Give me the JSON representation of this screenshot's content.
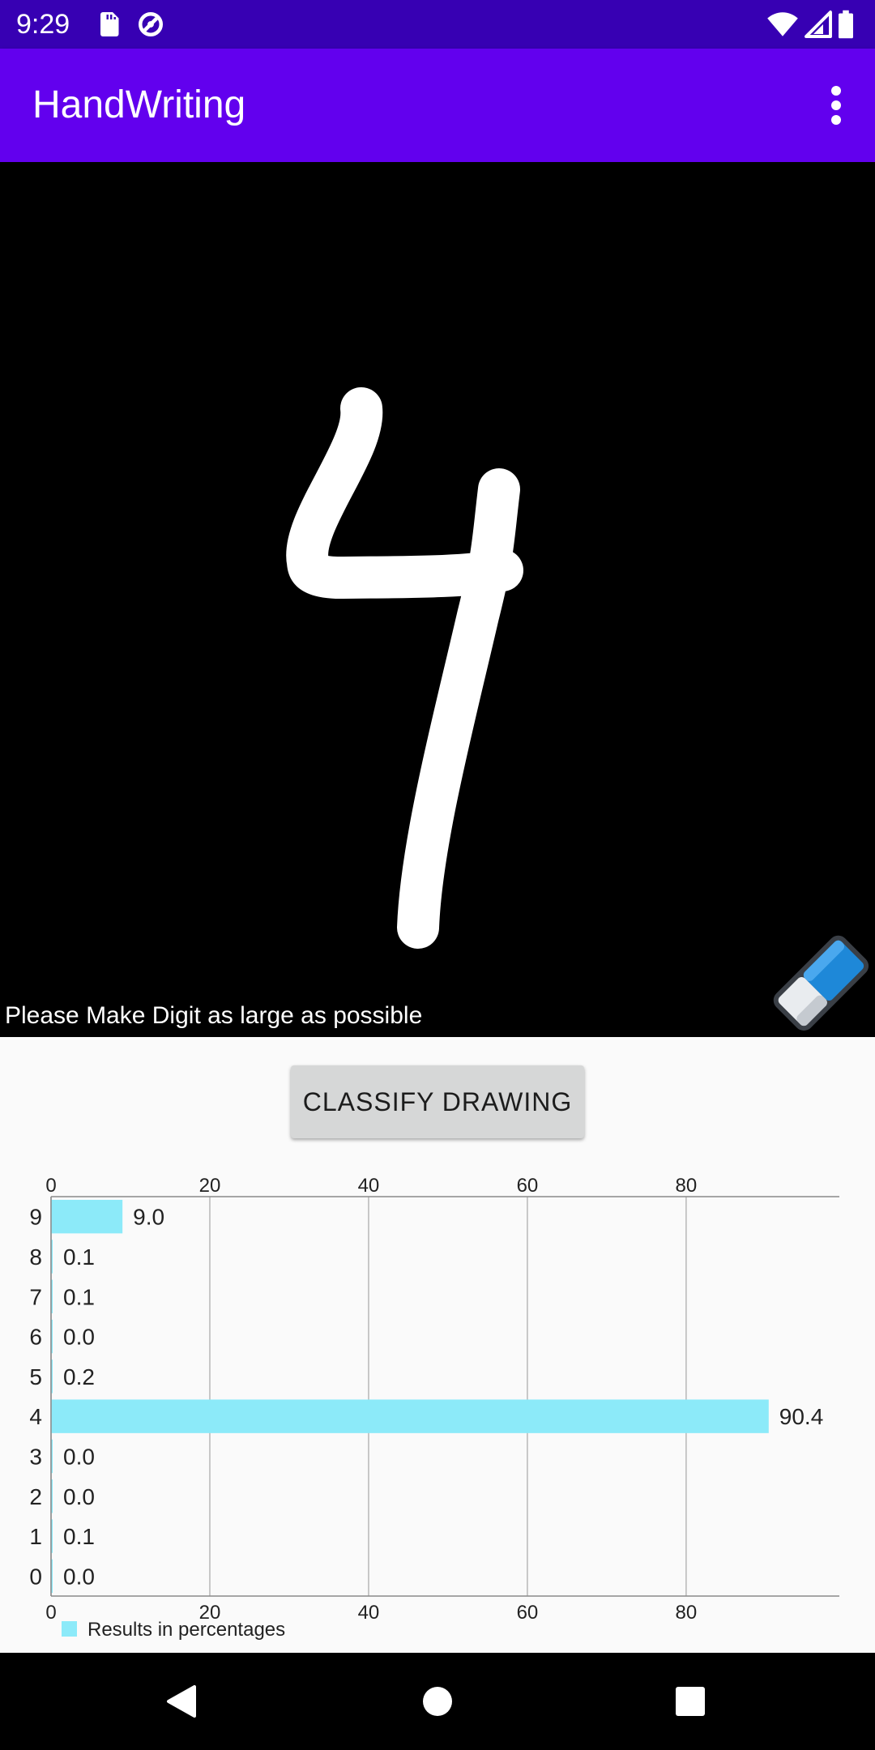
{
  "status_bar": {
    "time": "9:29",
    "left_icons": [
      "sd-card-icon",
      "data-saver-icon"
    ],
    "right_icons": [
      "wifi-icon",
      "cell-signal-icon",
      "battery-icon"
    ],
    "bar_color": "#3700b3"
  },
  "app_bar": {
    "title": "HandWriting",
    "menu_icon": "more-vert-icon",
    "bar_color": "#6200ee"
  },
  "canvas": {
    "hint": "Please Make Digit as large as possible",
    "eraser_icon": "eraser-icon",
    "background": "#000000",
    "stroke_color": "#ffffff"
  },
  "classify_button": {
    "label": "CLASSIFY DRAWING"
  },
  "chart_data": {
    "type": "bar",
    "orientation": "horizontal",
    "categories": [
      "0",
      "1",
      "2",
      "3",
      "4",
      "5",
      "6",
      "7",
      "8",
      "9"
    ],
    "values": [
      0.0,
      0.1,
      0.0,
      0.0,
      90.4,
      0.2,
      0.0,
      0.1,
      0.1,
      9.0
    ],
    "value_labels": [
      "0.0",
      "0.1",
      "0.0",
      "0.0",
      "90.4",
      "0.2",
      "0.0",
      "0.1",
      "0.1",
      "9.0"
    ],
    "xlim": [
      0,
      99.3
    ],
    "x_ticks": [
      "0",
      "20",
      "40",
      "60",
      "80"
    ],
    "x_axis_top": true,
    "x_axis_bottom": true,
    "grid": "vertical",
    "legend": {
      "label": "Results in percentages",
      "position": "bottom-left"
    },
    "bar_color": "#8ceaf9"
  },
  "nav_bar": {
    "buttons": [
      "back-icon",
      "home-icon",
      "recents-icon"
    ]
  }
}
